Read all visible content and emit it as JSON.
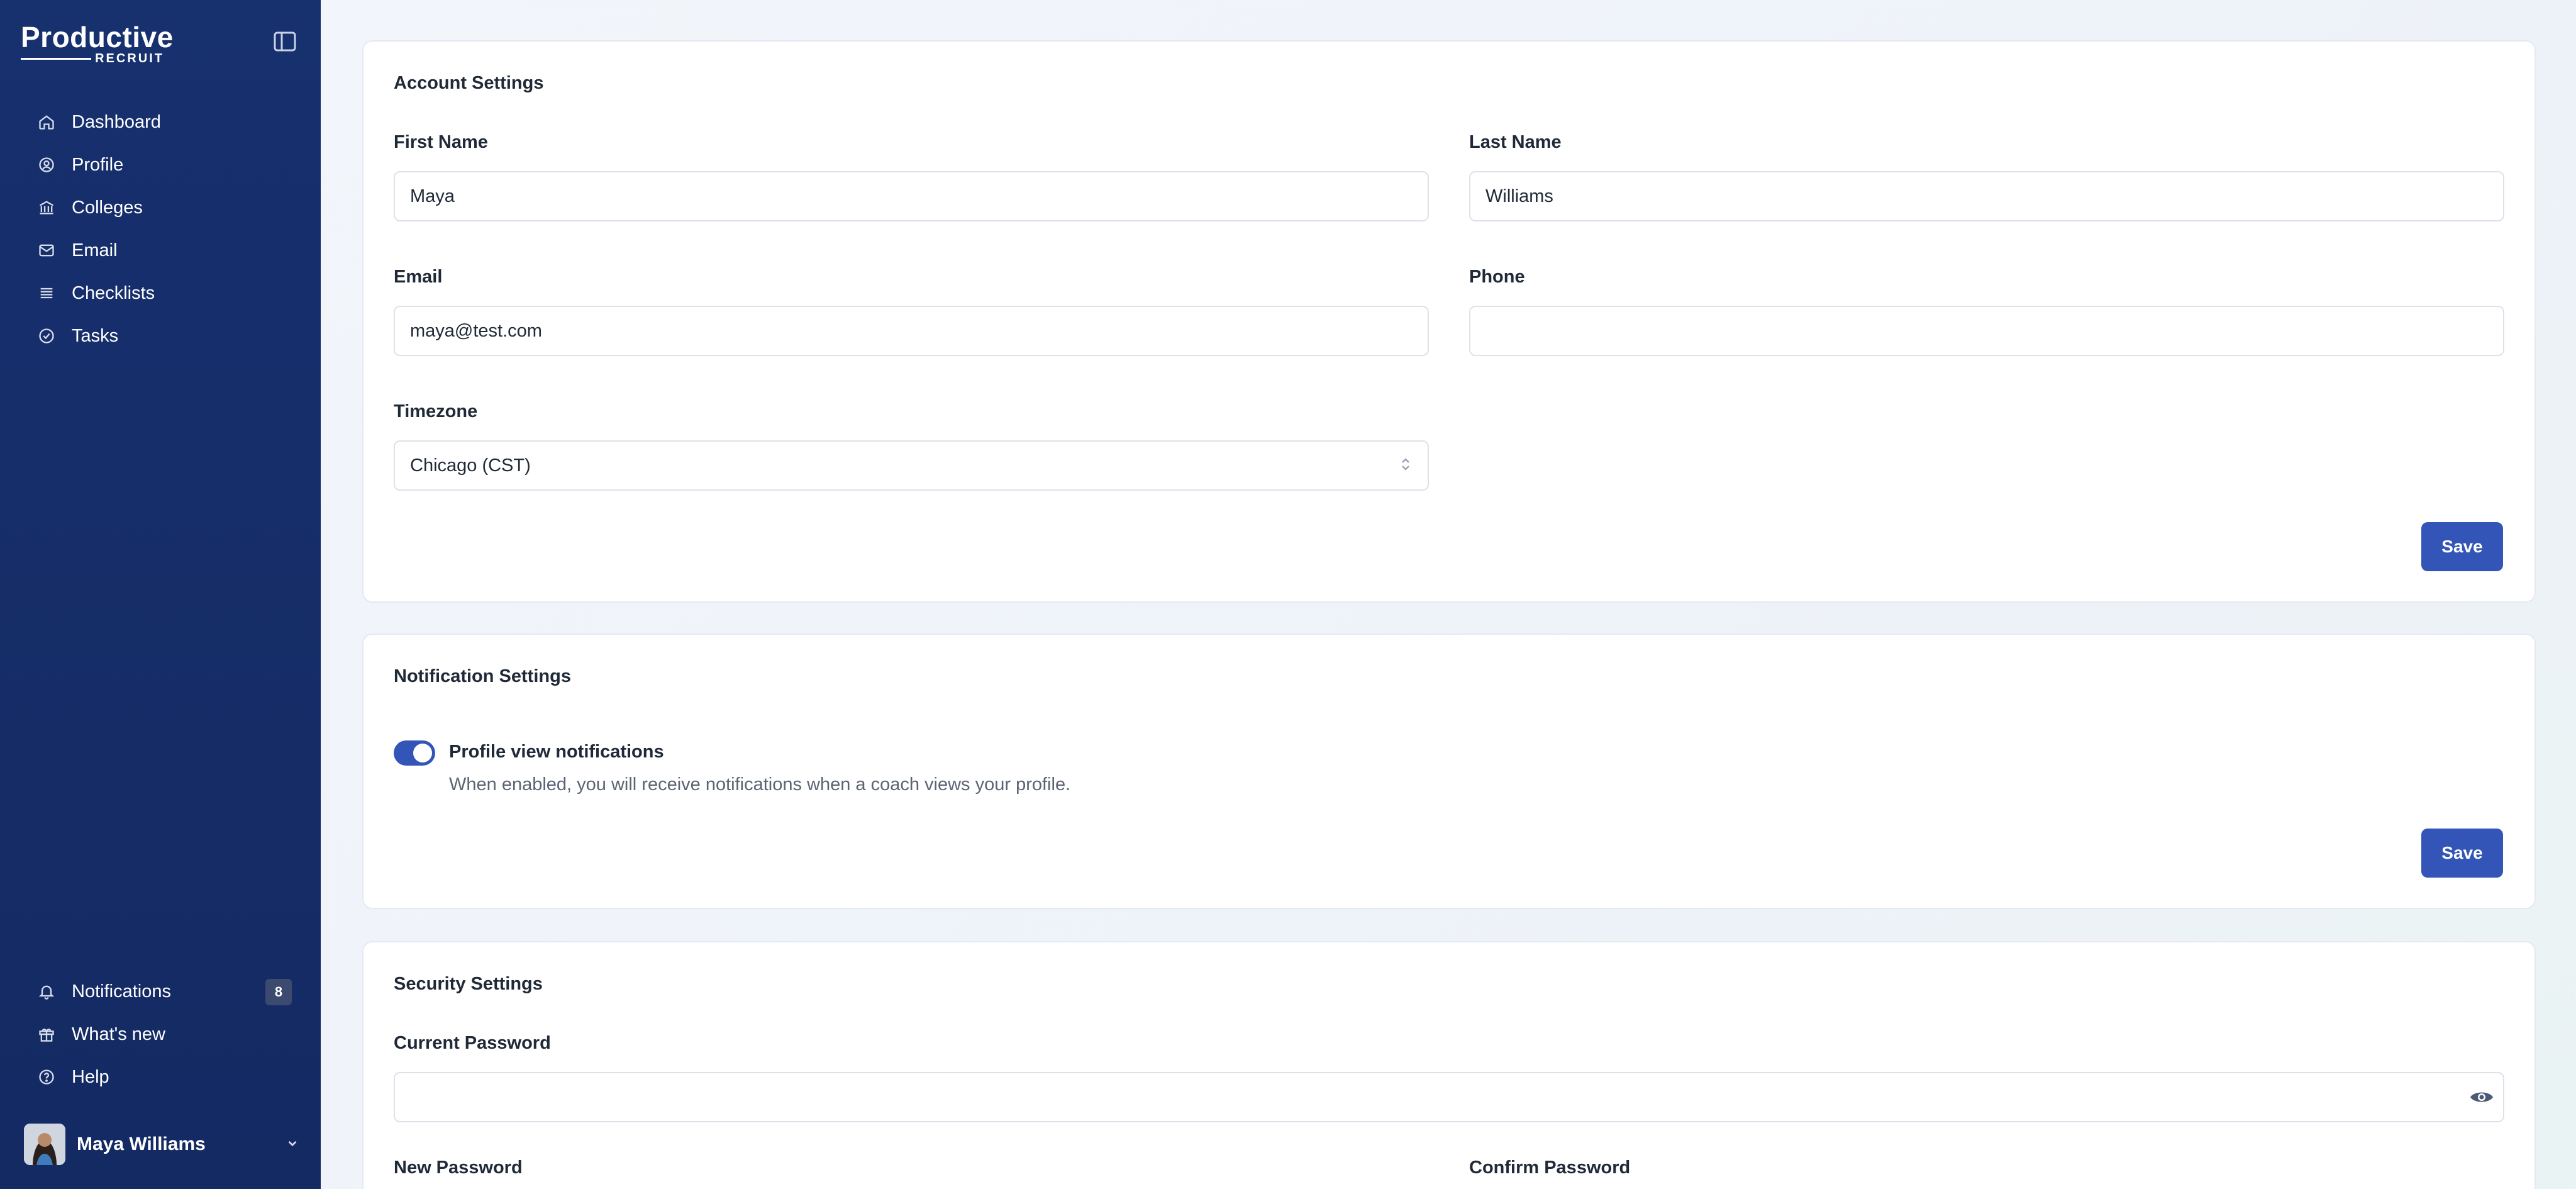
{
  "brand": {
    "name": "Productive",
    "sub": "RECRUIT"
  },
  "sidebar": {
    "items": [
      {
        "label": "Dashboard",
        "icon": "home-icon"
      },
      {
        "label": "Profile",
        "icon": "user-circle-icon"
      },
      {
        "label": "Colleges",
        "icon": "building-icon"
      },
      {
        "label": "Email",
        "icon": "mail-icon"
      },
      {
        "label": "Checklists",
        "icon": "list-icon"
      },
      {
        "label": "Tasks",
        "icon": "check-circle-icon"
      }
    ],
    "bottom": [
      {
        "label": "Notifications",
        "icon": "bell-icon",
        "badge": "8"
      },
      {
        "label": "What's new",
        "icon": "gift-icon"
      },
      {
        "label": "Help",
        "icon": "help-circle-icon"
      }
    ],
    "user": {
      "name": "Maya Williams"
    }
  },
  "account": {
    "title": "Account Settings",
    "first_name_label": "First Name",
    "first_name_value": "Maya",
    "last_name_label": "Last Name",
    "last_name_value": "Williams",
    "email_label": "Email",
    "email_value": "maya@test.com",
    "phone_label": "Phone",
    "phone_value": "",
    "timezone_label": "Timezone",
    "timezone_value": "Chicago (CST)",
    "save_label": "Save"
  },
  "notifications": {
    "title": "Notification Settings",
    "toggle_label": "Profile view notifications",
    "toggle_desc": "When enabled, you will receive notifications when a coach views your profile.",
    "toggle_on": true,
    "save_label": "Save"
  },
  "security": {
    "title": "Security Settings",
    "current_password_label": "Current Password",
    "new_password_label": "New Password",
    "confirm_password_label": "Confirm Password"
  },
  "colors": {
    "sidebar": "#17306e",
    "accent": "#3355b8"
  }
}
